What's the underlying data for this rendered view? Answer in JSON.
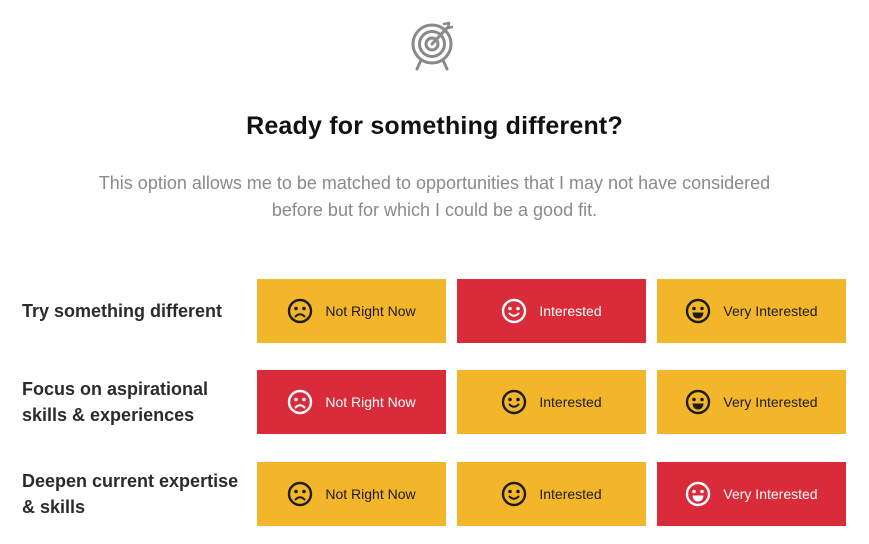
{
  "header": {
    "icon": "target-icon",
    "title": "Ready for something different?",
    "description": "This option allows me to be matched to opportunities that I may not have considered before but for which I could be a good fit."
  },
  "colors": {
    "option_default": "#f3b62a",
    "option_selected": "#d92b3a",
    "title": "#111111",
    "description": "#8a8a8a"
  },
  "options": [
    "Not Right Now",
    "Interested",
    "Very Interested"
  ],
  "option_icons": [
    "frown-face-icon",
    "smile-face-icon",
    "grin-face-icon"
  ],
  "rows": [
    {
      "label": "Try something different",
      "selected": "Interested"
    },
    {
      "label": "Focus on aspirational skills & experiences",
      "selected": "Not Right Now"
    },
    {
      "label": "Deepen current expertise & skills",
      "selected": "Very Interested"
    }
  ]
}
